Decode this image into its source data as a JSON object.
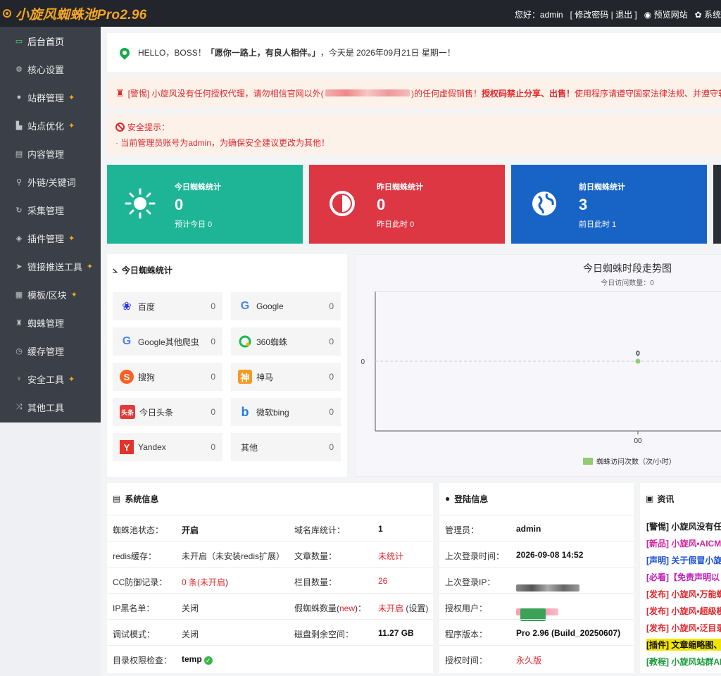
{
  "header": {
    "brand": "小旋风蜘蛛池Pro2.96",
    "greeting": "您好：admin",
    "user_links": "[ 修改密码 | 退出 ]",
    "preview": "预览网站",
    "system": "系统"
  },
  "sidebar": {
    "items": [
      {
        "label": "后台首页",
        "icon": "monitor-icon"
      },
      {
        "label": "核心设置",
        "icon": "gear-icon"
      },
      {
        "label": "站群管理",
        "icon": "user-icon"
      },
      {
        "label": "站点优化",
        "icon": "bar-chart-icon"
      },
      {
        "label": "内容管理",
        "icon": "document-icon"
      },
      {
        "label": "外链/关键词",
        "icon": "search-icon"
      },
      {
        "label": "采集管理",
        "icon": "refresh-icon"
      },
      {
        "label": "插件管理",
        "icon": "shield-icon"
      },
      {
        "label": "链接推送工具",
        "icon": "send-icon"
      },
      {
        "label": "模板/区块",
        "icon": "grid-icon"
      },
      {
        "label": "蜘蛛管理",
        "icon": "android-icon"
      },
      {
        "label": "缓存管理",
        "icon": "clock-icon"
      },
      {
        "label": "安全工具",
        "icon": "bulb-icon"
      },
      {
        "label": "其他工具",
        "icon": "shuffle-icon"
      }
    ]
  },
  "hello": {
    "prefix": "HELLO，BOSS！",
    "quote": "「愿你一路上，有良人相伴。」",
    "date": "，今天是 2026年09月21日 星期一！"
  },
  "warning": {
    "prefix": "[警惕] 小旋风没有任何授权代理，请勿相信官网以外(",
    "middle": ")的任何虚假销售！",
    "bold": "授权码禁止分享、出售！",
    "tail": "使用程序请遵守国家法律法规、并遵守软"
  },
  "security": {
    "title": "安全提示：",
    "line": "· 当前管理员账号为admin，为确保安全建议更改为其他！"
  },
  "cards": [
    {
      "title": "今日蜘蛛统计",
      "value": "0",
      "sub": "预计今日 0"
    },
    {
      "title": "昨日蜘蛛统计",
      "value": "0",
      "sub": "昨日此时 0"
    },
    {
      "title": "前日蜘蛛统计",
      "value": "3",
      "sub": "前日此时 1"
    }
  ],
  "spider_panel": {
    "title": "今日蜘蛛统计",
    "items": [
      {
        "name": "百度",
        "count": "0"
      },
      {
        "name": "Google",
        "count": "0"
      },
      {
        "name": "Google其他爬虫",
        "count": "0"
      },
      {
        "name": "360蜘蛛",
        "count": "0"
      },
      {
        "name": "搜狗",
        "count": "0"
      },
      {
        "name": "神马",
        "count": "0"
      },
      {
        "name": "今日头条",
        "count": "0"
      },
      {
        "name": "微软bing",
        "count": "0"
      },
      {
        "name": "Yandex",
        "count": "0"
      },
      {
        "name": "其他",
        "count": "0"
      }
    ]
  },
  "chart_data": {
    "type": "line",
    "title": "今日蜘蛛时段走势图",
    "subtitle": "今日访问数量：0",
    "categories": [
      "00"
    ],
    "series": [
      {
        "name": "蜘蛛访问次数（次/小时）",
        "values": [
          0
        ]
      }
    ],
    "ytick": "0",
    "color": "#91cc75"
  },
  "sysinfo": {
    "title": "系统信息",
    "rows": [
      {
        "k1": "蜘蛛池状态：",
        "v1": "开启",
        "k2": "域名库统计：",
        "v2": "1"
      },
      {
        "k1": "redis缓存：",
        "v1": "未开启（未安装redis扩展）",
        "k2": "文章数量：",
        "v2": "未统计"
      },
      {
        "k1": "CC防御记录：",
        "v1a": "0 条(",
        "v1b": "未开启",
        "v1c": ")",
        "k2": "栏目数量：",
        "v2": "26"
      },
      {
        "k1": "IP黑名单：",
        "v1": "关闭",
        "k2a": "假蜘蛛数量(",
        "k2b": "new",
        "k2c": ")：",
        "v2a": "未开启",
        "v2b": " (设置)"
      },
      {
        "k1": "调试模式：",
        "v1": "关闭",
        "k2": "磁盘剩余空间：",
        "v2": "11.27 GB"
      },
      {
        "k1": "目录权限检查：",
        "v1": "temp"
      }
    ]
  },
  "login": {
    "title": "登陆信息",
    "rows": [
      {
        "k": "管理员：",
        "v": "admin"
      },
      {
        "k": "上次登录时间：",
        "v": "2026-09-08 14:52"
      },
      {
        "k": "上次登录IP：",
        "v": ""
      },
      {
        "k": "授权用户：",
        "v": ""
      },
      {
        "k": "程序版本：",
        "v": "Pro 2.96 (Build_20250607)"
      },
      {
        "k": "授权时间：",
        "v": "永久版"
      }
    ]
  },
  "news": {
    "title": "资讯",
    "items": [
      {
        "text": "[警惕] 小旋风没有任",
        "color": "#222222",
        "bg": ""
      },
      {
        "text": "[新品] 小旋风•AICM",
        "color": "#d6249f",
        "bg": ""
      },
      {
        "text": "[声明] 关于假冒小旋",
        "color": "#1a4fd6",
        "bg": ""
      },
      {
        "text": "[必看]【免责声明以",
        "color": "#c21fb8",
        "bg": ""
      },
      {
        "text": "[发布] 小旋风•万能蜘",
        "color": "#e0282e",
        "bg": ""
      },
      {
        "text": "[发布] 小旋风•超级模",
        "color": "#e0282e",
        "bg": ""
      },
      {
        "text": "[发布] 小旋风•泛目录",
        "color": "#e0282e",
        "bg": ""
      },
      {
        "text": "[插件] 文章缩略图、",
        "color": "#111111",
        "bg": "#f2e600"
      },
      {
        "text": "[教程] 小旋风站群AI",
        "color": "#1a9a3a",
        "bg": ""
      }
    ]
  }
}
